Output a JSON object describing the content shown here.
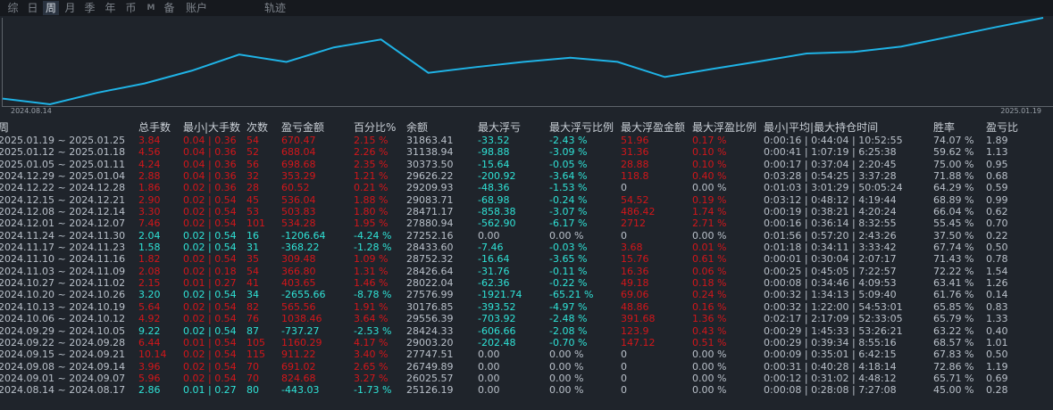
{
  "tabs": [
    {
      "label": "综",
      "active": false
    },
    {
      "label": "日",
      "active": false
    },
    {
      "label": "周",
      "active": true
    },
    {
      "label": "月",
      "active": false
    },
    {
      "label": "季",
      "active": false
    },
    {
      "label": "年",
      "active": false
    },
    {
      "label": "币",
      "active": false
    },
    {
      "label": "M",
      "active": false
    },
    {
      "label": "备",
      "active": false
    },
    {
      "label": "账户",
      "active": false
    },
    {
      "label": "轨迹",
      "active": false
    }
  ],
  "chart": {
    "x_start_label": "2024.08.14",
    "x_end_label": "2025.01.19",
    "line_color": "#1fb3e6",
    "values": [
      25569.22,
      25126.19,
      26025.57,
      26749.89,
      27747.51,
      29003.2,
      28424.33,
      29556.39,
      30176.85,
      27576.99,
      28022.04,
      28426.64,
      28752.32,
      28433.6,
      27252.16,
      27880.94,
      28471.17,
      29083.71,
      29209.93,
      29626.22,
      30373.5,
      31138.94,
      31863.41
    ]
  },
  "colors": {
    "profit": "#d3161a",
    "loss": "#2fe2d6",
    "neutral": "#b9c0c9"
  },
  "table": {
    "headers": [
      "周",
      "总手数",
      "最小|大手数",
      "次数",
      "盈亏金额",
      "百分比%",
      "余额",
      "最大浮亏",
      "最大浮亏比例",
      "最大浮盈金额",
      "最大浮盈比例",
      "最小|平均|最大持仓时间",
      "胜率",
      "盈亏比"
    ],
    "rows": [
      [
        "2025.01.19 ~ 2025.01.25",
        "3.84",
        "0.04 | 0.36",
        "54",
        "670.47",
        "2.15 %",
        "31863.41",
        "-33.52",
        "-2.43 %",
        "51.96",
        "0.17 %",
        "0:00:16 | 0:44:04 | 10:52:55",
        "74.07 %",
        "1.89"
      ],
      [
        "2025.01.12 ~ 2025.01.18",
        "4.56",
        "0.04 | 0.36",
        "52",
        "688.04",
        "2.26 %",
        "31138.94",
        "-98.88",
        "-3.09 %",
        "31.36",
        "0.10 %",
        "0:00:41 | 1:07:19 | 6:25:38",
        "59.62 %",
        "1.13"
      ],
      [
        "2025.01.05 ~ 2025.01.11",
        "4.24",
        "0.04 | 0.36",
        "56",
        "698.68",
        "2.35 %",
        "30373.50",
        "-15.64",
        "-0.05 %",
        "28.88",
        "0.10 %",
        "0:00:17 | 0:37:04 | 2:20:45",
        "75.00 %",
        "0.95"
      ],
      [
        "2024.12.29 ~ 2025.01.04",
        "2.88",
        "0.04 | 0.36",
        "32",
        "353.29",
        "1.21 %",
        "29626.22",
        "-200.92",
        "-3.64 %",
        "118.8",
        "0.40 %",
        "0:03:28 | 0:54:25 | 3:37:28",
        "71.88 %",
        "0.68"
      ],
      [
        "2024.12.22 ~ 2024.12.28",
        "1.86",
        "0.02 | 0.36",
        "28",
        "60.52",
        "0.21 %",
        "29209.93",
        "-48.36",
        "-1.53 %",
        "0",
        "0.00 %",
        "0:01:03 | 3:01:29 | 50:05:24",
        "64.29 %",
        "0.59"
      ],
      [
        "2024.12.15 ~ 2024.12.21",
        "2.90",
        "0.02 | 0.54",
        "45",
        "536.04",
        "1.88 %",
        "29083.71",
        "-68.98",
        "-0.24 %",
        "54.52",
        "0.19 %",
        "0:03:12 | 0:48:12 | 4:19:44",
        "68.89 %",
        "0.99"
      ],
      [
        "2024.12.08 ~ 2024.12.14",
        "3.30",
        "0.02 | 0.54",
        "53",
        "503.83",
        "1.80 %",
        "28471.17",
        "-858.38",
        "-3.07 %",
        "486.42",
        "1.74 %",
        "0:00:19 | 0:38:21 | 4:20:24",
        "66.04 %",
        "0.62"
      ],
      [
        "2024.12.01 ~ 2024.12.07",
        "7.46",
        "0.02 | 0.54",
        "101",
        "534.28",
        "1.95 %",
        "27880.94",
        "-562.90",
        "-6.17 %",
        "2712",
        "2.71 %",
        "0:00:16 | 0:36:14 | 8:32:55",
        "55.45 %",
        "0.70"
      ],
      [
        "2024.11.24 ~ 2024.11.30",
        "2.04",
        "0.02 | 0.54",
        "16",
        "-1206.64",
        "-4.24 %",
        "27252.16",
        "0.00",
        "0.00 %",
        "0",
        "0.00 %",
        "0:01:56 | 0:57:20 | 2:43:26",
        "37.50 %",
        "0.22"
      ],
      [
        "2024.11.17 ~ 2024.11.23",
        "1.58",
        "0.02 | 0.54",
        "31",
        "-368.22",
        "-1.28 %",
        "28433.60",
        "-7.46",
        "-0.03 %",
        "3.68",
        "0.01 %",
        "0:01:18 | 0:34:11 | 3:33:42",
        "67.74 %",
        "0.50"
      ],
      [
        "2024.11.10 ~ 2024.11.16",
        "1.82",
        "0.02 | 0.54",
        "35",
        "309.48",
        "1.09 %",
        "28752.32",
        "-16.64",
        "-3.65 %",
        "15.76",
        "0.61 %",
        "0:00:01 | 0:30:04 | 2:07:17",
        "71.43 %",
        "0.78"
      ],
      [
        "2024.11.03 ~ 2024.11.09",
        "2.08",
        "0.02 | 0.18",
        "54",
        "366.80",
        "1.31 %",
        "28426.64",
        "-31.76",
        "-0.11 %",
        "16.36",
        "0.06 %",
        "0:00:25 | 0:45:05 | 7:22:57",
        "72.22 %",
        "1.54"
      ],
      [
        "2024.10.27 ~ 2024.11.02",
        "2.15",
        "0.01 | 0.27",
        "41",
        "403.65",
        "1.46 %",
        "28022.04",
        "-62.36",
        "-0.22 %",
        "49.18",
        "0.18 %",
        "0:00:08 | 0:34:46 | 4:09:53",
        "63.41 %",
        "1.26"
      ],
      [
        "2024.10.20 ~ 2024.10.26",
        "3.20",
        "0.02 | 0.54",
        "34",
        "-2655.66",
        "-8.78 %",
        "27576.99",
        "-1921.74",
        "-65.21 %",
        "69.06",
        "0.24 %",
        "0:00:32 | 1:34:13 | 5:09:40",
        "61.76 %",
        "0.14"
      ],
      [
        "2024.10.13 ~ 2024.10.19",
        "5.64",
        "0.02 | 0.54",
        "82",
        "565.56",
        "1.91 %",
        "30176.85",
        "-393.52",
        "-4.97 %",
        "48.86",
        "0.16 %",
        "0:00:32 | 1:22:00 | 54:53:01",
        "65.85 %",
        "0.83"
      ],
      [
        "2024.10.06 ~ 2024.10.12",
        "4.92",
        "0.02 | 0.54",
        "76",
        "1038.46",
        "3.64 %",
        "29556.39",
        "-703.92",
        "-2.48 %",
        "391.68",
        "1.36 %",
        "0:02:17 | 2:17:09 | 52:33:05",
        "65.79 %",
        "1.33"
      ],
      [
        "2024.09.29 ~ 2024.10.05",
        "9.22",
        "0.02 | 0.54",
        "87",
        "-737.27",
        "-2.53 %",
        "28424.33",
        "-606.66",
        "-2.08 %",
        "123.9",
        "0.43 %",
        "0:00:29 | 1:45:33 | 53:26:21",
        "63.22 %",
        "0.40"
      ],
      [
        "2024.09.22 ~ 2024.09.28",
        "6.44",
        "0.01 | 0.54",
        "105",
        "1160.29",
        "4.17 %",
        "29003.20",
        "-202.48",
        "-0.70 %",
        "147.12",
        "0.51 %",
        "0:00:29 | 0:39:34 | 8:55:16",
        "68.57 %",
        "1.01"
      ],
      [
        "2024.09.15 ~ 2024.09.21",
        "10.14",
        "0.02 | 0.54",
        "115",
        "911.22",
        "3.40 %",
        "27747.51",
        "0.00",
        "0.00 %",
        "0",
        "0.00 %",
        "0:00:09 | 0:35:01 | 6:42:15",
        "67.83 %",
        "0.50"
      ],
      [
        "2024.09.08 ~ 2024.09.14",
        "3.96",
        "0.02 | 0.54",
        "70",
        "691.02",
        "2.65 %",
        "26749.89",
        "0.00",
        "0.00 %",
        "0",
        "0.00 %",
        "0:00:31 | 0:40:28 | 4:18:14",
        "72.86 %",
        "1.19"
      ],
      [
        "2024.09.01 ~ 2024.09.07",
        "5.96",
        "0.02 | 0.54",
        "70",
        "824.68",
        "3.27 %",
        "26025.57",
        "0.00",
        "0.00 %",
        "0",
        "0.00 %",
        "0:00:12 | 0:31:02 | 4:48:12",
        "65.71 %",
        "0.69"
      ],
      [
        "2024.08.14 ~ 2024.08.17",
        "2.86",
        "0.01 | 0.27",
        "80",
        "-443.03",
        "-1.73 %",
        "25126.19",
        "0.00",
        "0.00 %",
        "0",
        "0.00 %",
        "0:00:08 | 0:28:08 | 7:27:08",
        "45.00 %",
        "0.28"
      ]
    ]
  }
}
